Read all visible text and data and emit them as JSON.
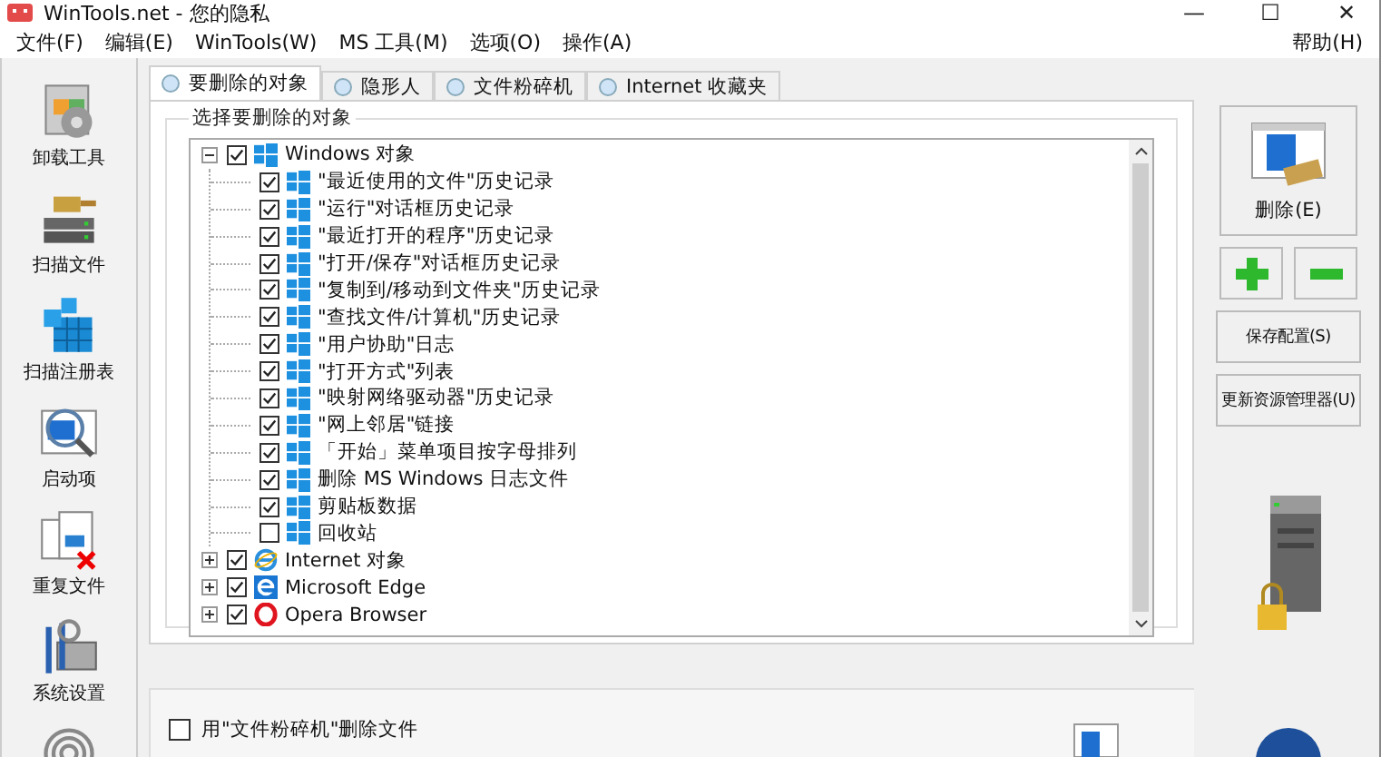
{
  "window": {
    "title": "WinTools.net - 您的隐私",
    "controls": [
      "—",
      "☐",
      "✕"
    ]
  },
  "menu": {
    "items": [
      "文件(F)",
      "编辑(E)",
      "WinTools(W)",
      "MS 工具(M)",
      "选项(O)",
      "操作(A)"
    ],
    "help": "帮助(H)"
  },
  "sidebar": {
    "items": [
      {
        "kind": "uninstall",
        "label": "卸载工具"
      },
      {
        "kind": "scan-files",
        "label": "扫描文件"
      },
      {
        "kind": "registry",
        "label": "扫描注册表"
      },
      {
        "kind": "startup",
        "label": "启动项"
      },
      {
        "kind": "duplicates",
        "label": "重复文件"
      },
      {
        "kind": "settings",
        "label": "系统设置"
      },
      {
        "kind": "fingerprint"
      }
    ]
  },
  "tabs": [
    {
      "label": "要删除的对象",
      "selected": true
    },
    {
      "label": "隐形人",
      "selected": false
    },
    {
      "label": "文件粉碎机",
      "selected": false
    },
    {
      "label": "Internet 收藏夹",
      "selected": false
    }
  ],
  "group": {
    "title": "选择要删除的对象",
    "tree": [
      {
        "label": "Windows 对象",
        "kind": "windows",
        "checked": true,
        "expanded": true,
        "children": [
          {
            "label": "\"最近使用的文件\"历史记录",
            "kind": "windows",
            "checked": true
          },
          {
            "label": "\"运行\"对话框历史记录",
            "kind": "windows",
            "checked": true
          },
          {
            "label": "\"最近打开的程序\"历史记录",
            "kind": "windows",
            "checked": true
          },
          {
            "label": "\"打开/保存\"对话框历史记录",
            "kind": "windows",
            "checked": true
          },
          {
            "label": "\"复制到/移动到文件夹\"历史记录",
            "kind": "windows",
            "checked": true
          },
          {
            "label": "\"查找文件/计算机\"历史记录",
            "kind": "windows",
            "checked": true
          },
          {
            "label": "\"用户协助\"日志",
            "kind": "windows",
            "checked": true
          },
          {
            "label": "\"打开方式\"列表",
            "kind": "windows",
            "checked": true
          },
          {
            "label": "\"映射网络驱动器\"历史记录",
            "kind": "windows",
            "checked": true
          },
          {
            "label": "\"网上邻居\"链接",
            "kind": "windows",
            "checked": true
          },
          {
            "label": "「开始」菜单项目按字母排列",
            "kind": "windows",
            "checked": true
          },
          {
            "label": "删除 MS Windows 日志文件",
            "kind": "windows",
            "checked": true
          },
          {
            "label": "剪贴板数据",
            "kind": "windows",
            "checked": true
          },
          {
            "label": "回收站",
            "kind": "windows",
            "checked": false
          }
        ]
      },
      {
        "label": "Internet 对象",
        "kind": "ie",
        "checked": true,
        "expanded": false
      },
      {
        "label": "Microsoft Edge",
        "kind": "edge",
        "checked": true,
        "expanded": false
      },
      {
        "label": "Opera Browser",
        "kind": "opera",
        "checked": true,
        "expanded": false
      }
    ]
  },
  "shredder_option": {
    "label": "用\"文件粉碎机\"删除文件",
    "checked": false
  },
  "actions": {
    "delete": "删除(E)",
    "save": "保存配置(S)",
    "refresh": "更新资源管理器(U)"
  }
}
